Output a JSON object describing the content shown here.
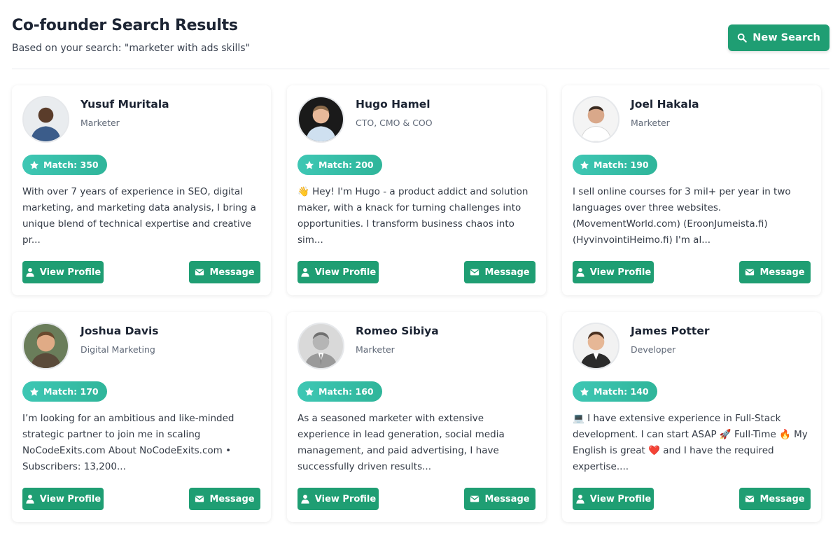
{
  "header": {
    "title": "Co-founder Search Results",
    "subtitle": "Based on your search: \"marketer with ads skills\"",
    "new_search_label": "New Search"
  },
  "buttons": {
    "view_profile": "View Profile",
    "message": "Message"
  },
  "colors": {
    "primary": "#1f9e73",
    "badge_start": "#3ec7b4",
    "badge_end": "#2fb59a"
  },
  "results": [
    {
      "name": "Yusuf Muritala",
      "role": "Marketer",
      "match": "Match: 350",
      "bio": "With over 7 years of experience in SEO, digital marketing, and marketing data analysis, I bring a unique blend of technical expertise and creative pr..."
    },
    {
      "name": "Hugo Hamel",
      "role": "CTO, CMO & COO",
      "match": "Match: 200",
      "bio": "👋 Hey! I'm Hugo - a product addict and solution maker, with a knack for turning challenges into opportunities. I transform business chaos into sim..."
    },
    {
      "name": "Joel Hakala",
      "role": "Marketer",
      "match": "Match: 190",
      "bio": "I sell online courses for 3 mil+ per year in two languages over three websites. (MovementWorld.com) (EroonJumeista.fi) (HyvinvointiHeimo.fi) I'm al..."
    },
    {
      "name": "Joshua Davis",
      "role": "Digital Marketing",
      "match": "Match: 170",
      "bio": "I’m looking for an ambitious and like-minded strategic partner to join me in scaling NoCodeExits.com About NoCodeExits.com • Subscribers: 13,200..."
    },
    {
      "name": "Romeo Sibiya",
      "role": "Marketer",
      "match": "Match: 160",
      "bio": "As a seasoned marketer with extensive experience in lead generation, social media management, and paid advertising, I have successfully driven results..."
    },
    {
      "name": "James Potter",
      "role": "Developer",
      "match": "Match: 140",
      "bio": "💻 I have extensive experience in Full-Stack development. I can start ASAP 🚀 Full-Time 🔥 My English is great ❤️ and I have the required expertise...."
    }
  ]
}
